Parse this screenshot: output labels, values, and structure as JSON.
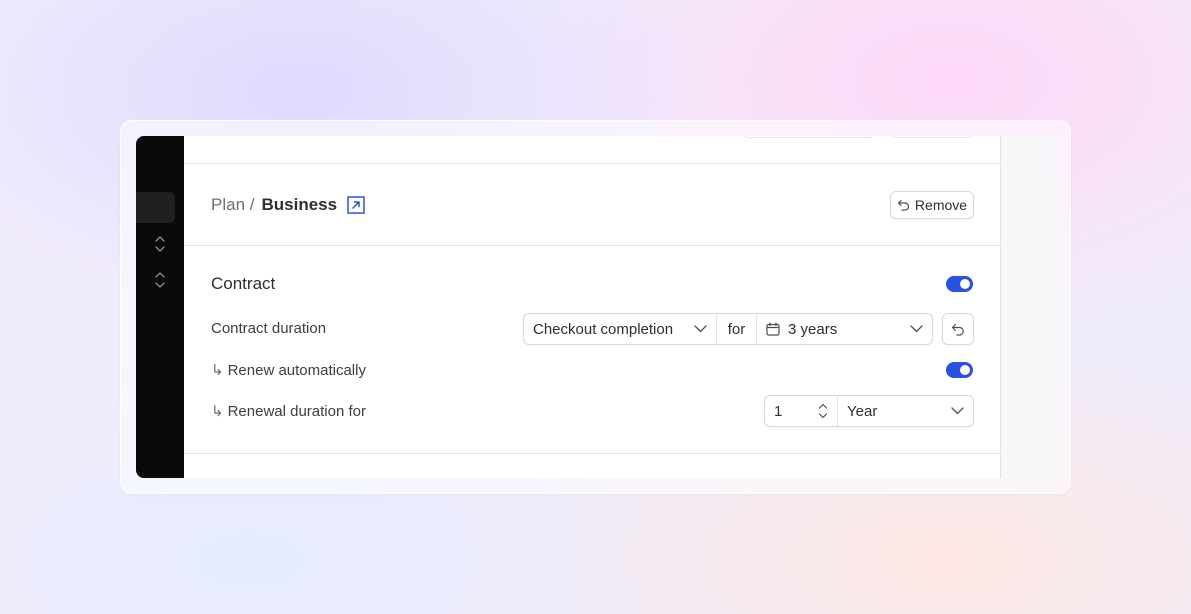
{
  "breadcrumb": {
    "parent": "Plan /",
    "current": "Business"
  },
  "buttons": {
    "remove_label": "Remove"
  },
  "contract": {
    "title": "Contract",
    "enabled": true,
    "duration_label": "Contract duration",
    "start_trigger": "Checkout completion",
    "for_label": "for",
    "duration_value": "3 years",
    "renew_label": "Renew automatically",
    "renew_enabled": true,
    "renewal_label": "Renewal duration for",
    "renewal_count": "1",
    "renewal_unit": "Year"
  },
  "icons": {
    "external_link": "external-link-icon",
    "undo": "undo-icon",
    "calendar": "calendar-icon",
    "chevron_down": "chevron-down-icon",
    "stepper": "stepper-icon",
    "return_arrow": "↳"
  },
  "colors": {
    "accent": "#2952e0",
    "sidebar": "#090909"
  }
}
